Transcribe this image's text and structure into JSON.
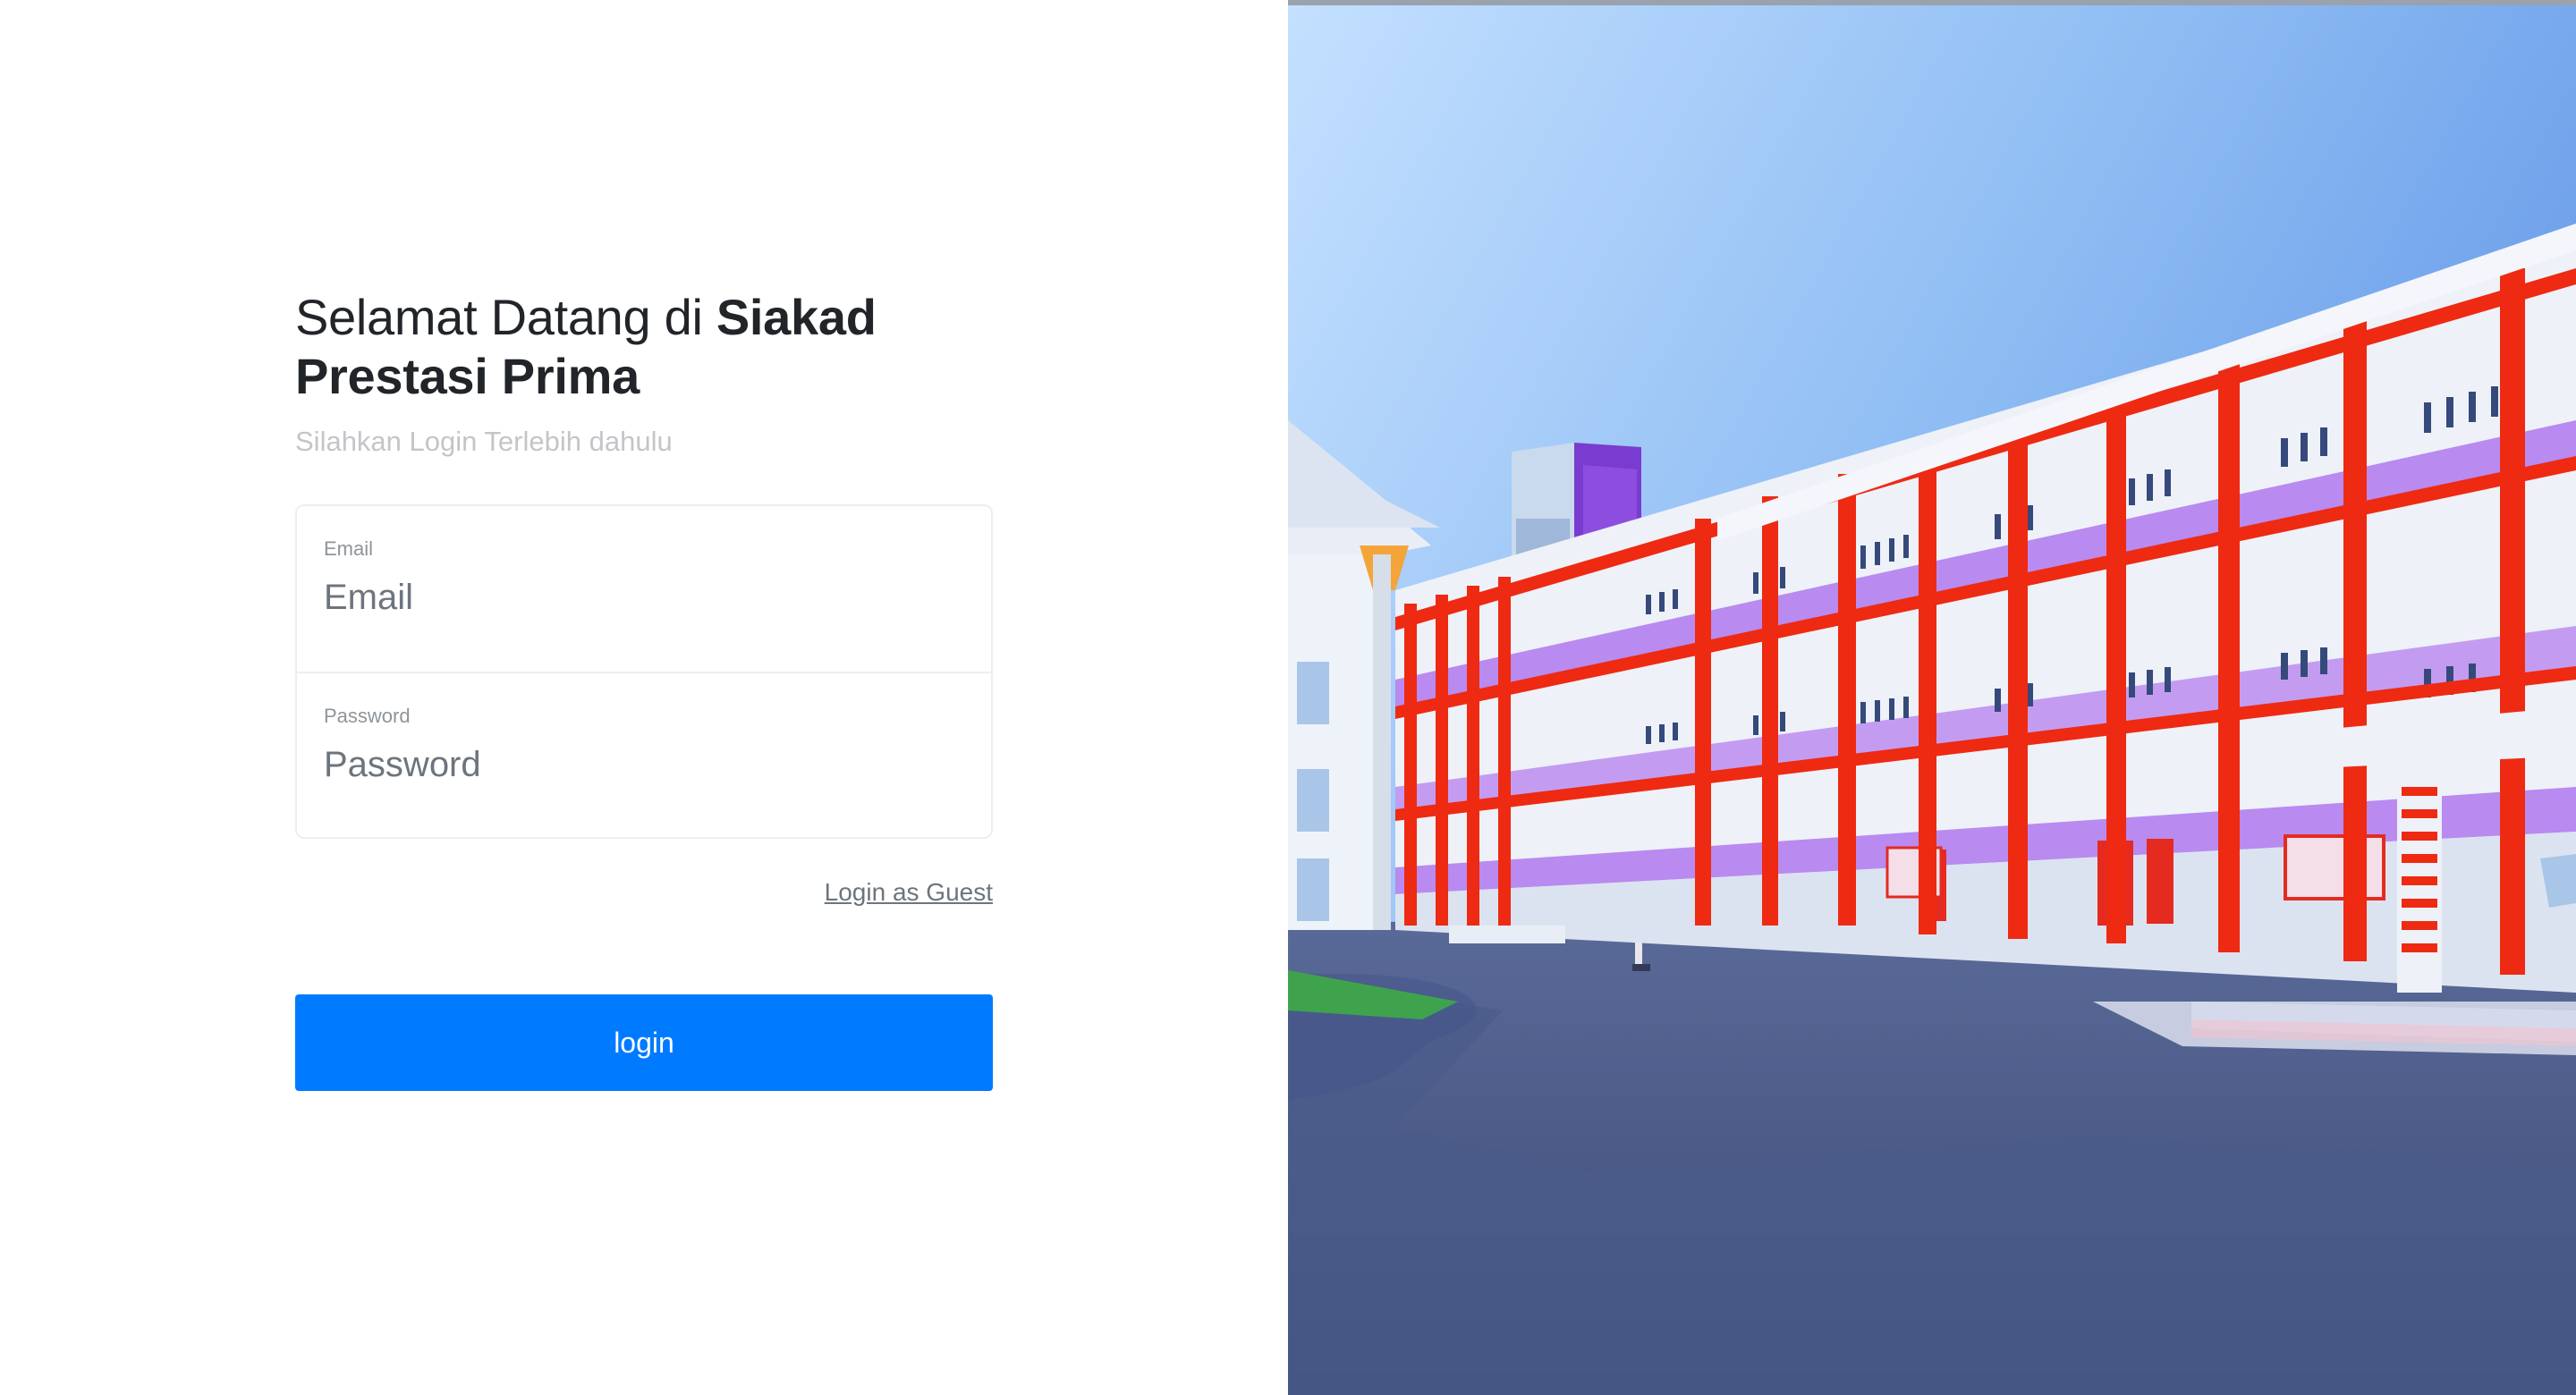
{
  "heading": {
    "prefix": "Selamat Datang di ",
    "brand": "Siakad Prestasi Prima"
  },
  "subtitle": "Silahkan Login Terlebih dahulu",
  "form": {
    "email": {
      "label": "Email",
      "placeholder": "Email",
      "value": ""
    },
    "password": {
      "label": "Password",
      "placeholder": "Password",
      "value": ""
    }
  },
  "guest_link": "Login as Guest",
  "login_button": "login",
  "colors": {
    "primary": "#007bff",
    "building_accent": "#ee2a12",
    "stripe": "#b98af0",
    "road": "#4a5a86"
  },
  "illustration": {
    "icon": "campus-building-illustration"
  }
}
